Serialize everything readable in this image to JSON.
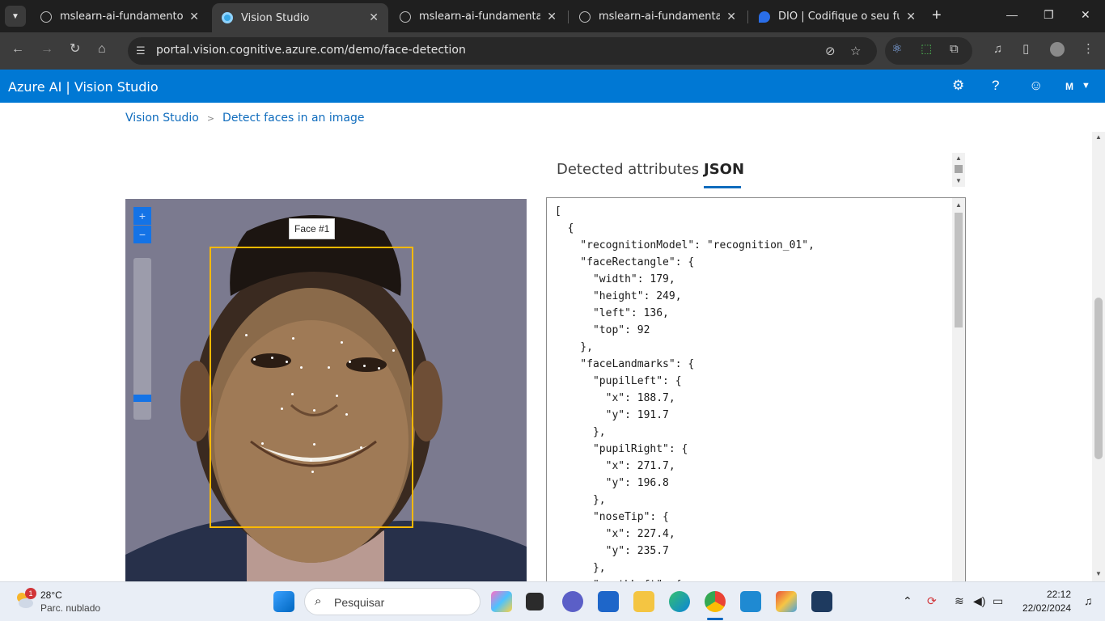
{
  "browser": {
    "tabs": [
      {
        "title": "mslearn-ai-fundamentos",
        "icon": "globe-icon",
        "active": false
      },
      {
        "title": "Vision Studio",
        "icon": "vision-studio-icon",
        "active": true
      },
      {
        "title": "mslearn-ai-fundamentals",
        "icon": "globe-icon",
        "active": false
      },
      {
        "title": "mslearn-ai-fundamentals",
        "icon": "globe-icon",
        "active": false
      },
      {
        "title": "DIO | Codifique o seu futuro",
        "icon": "dio-icon",
        "active": false
      }
    ],
    "url": "portal.vision.cognitive.azure.com/demo/face-detection"
  },
  "app": {
    "brand": "Azure AI  |  Vision Studio",
    "user_initial": "M",
    "accent": "#0078d4"
  },
  "breadcrumb": {
    "root": "Vision Studio",
    "current": "Detect faces in an image"
  },
  "viewer": {
    "face_label": "Face #1",
    "box_color": "#ffb900",
    "zoom_in": "+",
    "zoom_out": "−"
  },
  "results": {
    "tabs": [
      {
        "label": "Detected attributes",
        "active": false
      },
      {
        "label": "JSON",
        "active": true
      }
    ],
    "json_text": "[\n  {\n    \"recognitionModel\": \"recognition_01\",\n    \"faceRectangle\": {\n      \"width\": 179,\n      \"height\": 249,\n      \"left\": 136,\n      \"top\": 92\n    },\n    \"faceLandmarks\": {\n      \"pupilLeft\": {\n        \"x\": 188.7,\n        \"y\": 191.7\n      },\n      \"pupilRight\": {\n        \"x\": 271.7,\n        \"y\": 196.8\n      },\n      \"noseTip\": {\n        \"x\": 227.4,\n        \"y\": 235.7\n      },\n      \"mouthLeft\": {"
  },
  "taskbar": {
    "weather_temp": "28°C",
    "weather_desc": "Parc. nublado",
    "weather_badge": "1",
    "search_placeholder": "Pesquisar",
    "time": "22:12",
    "date": "22/02/2024"
  }
}
